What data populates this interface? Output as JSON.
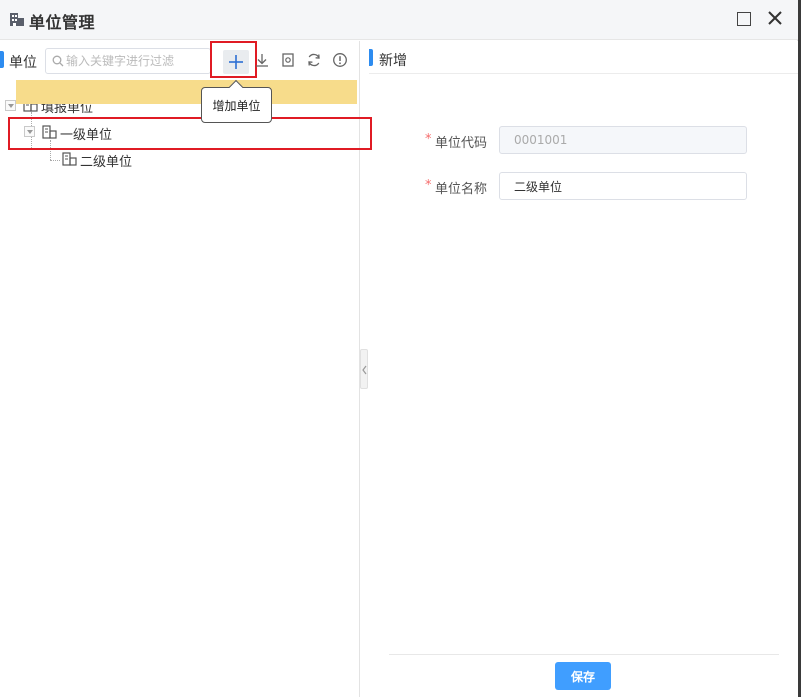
{
  "window": {
    "title": "单位管理",
    "icons": {
      "title": "building-icon",
      "maximize": "maximize-icon",
      "close": "close-icon"
    }
  },
  "left_pane": {
    "label": "单位",
    "search": {
      "placeholder": "输入关键字进行过滤",
      "value": ""
    },
    "toolbar": {
      "add": {
        "icon": "plus-icon",
        "tooltip": "增加单位"
      },
      "download": {
        "icon": "download-icon"
      },
      "preview": {
        "icon": "preview-icon"
      },
      "refresh": {
        "icon": "refresh-icon"
      },
      "info": {
        "icon": "info-icon"
      }
    },
    "tree": [
      {
        "label": "填报单位",
        "expanded": true,
        "selected": false
      },
      {
        "label": "一级单位",
        "expanded": true,
        "selected": true
      },
      {
        "label": "二级单位",
        "expanded": false,
        "selected": false
      }
    ]
  },
  "right_pane": {
    "title": "新增",
    "form": {
      "code": {
        "label": "单位代码",
        "value": "0001001",
        "disabled": true
      },
      "name": {
        "label": "单位名称",
        "value": "二级单位",
        "disabled": false
      }
    },
    "save_label": "保存"
  },
  "colors": {
    "accent": "#2d8cf0",
    "selected_row": "#f7dc8b",
    "highlight_box": "#e01b24",
    "save_button": "#409eff",
    "required_mark": "#f56c6c"
  }
}
